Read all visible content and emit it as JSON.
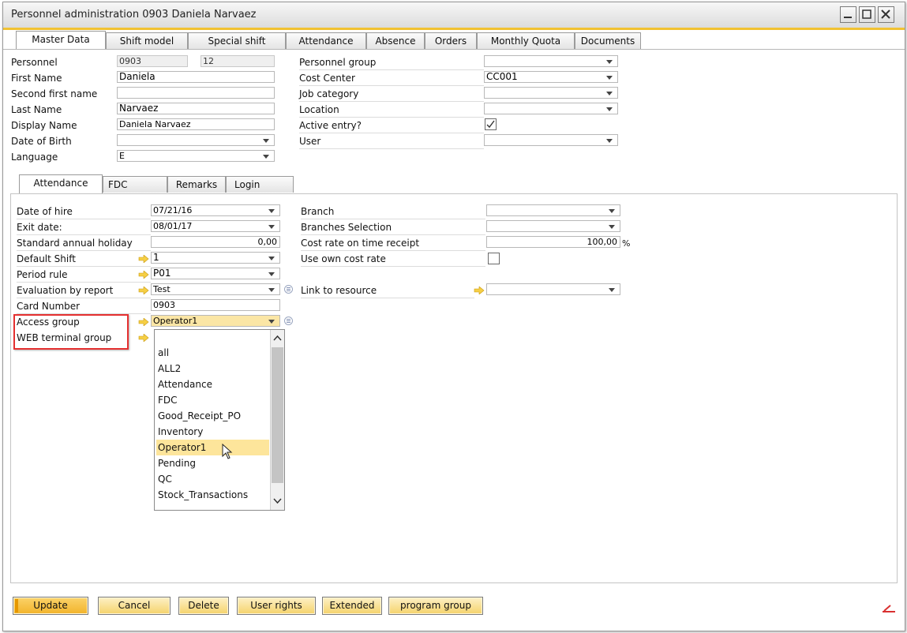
{
  "window": {
    "title": "Personnel administration 0903 Daniela Narvaez"
  },
  "main_tabs": [
    "Master Data",
    "Shift model",
    "Special shift",
    "Attendance",
    "Absence",
    "Orders",
    "Monthly Quota",
    "Documents"
  ],
  "header_left": {
    "personnel_label": "Personnel",
    "personnel_value": "0903",
    "personnel_value2": "12",
    "first_name_label": "First Name",
    "first_name_value": "Daniela",
    "second_first_name_label": "Second first name",
    "second_first_name_value": "",
    "last_name_label": "Last Name",
    "last_name_value": "Narvaez",
    "display_name_label": "Display Name",
    "display_name_value": "Daniela Narvaez",
    "dob_label": "Date of Birth",
    "dob_value": "",
    "language_label": "Language",
    "language_value": "E"
  },
  "header_right": {
    "personnel_group_label": "Personnel group",
    "personnel_group_value": "",
    "cost_center_label": "Cost Center",
    "cost_center_value": "CC001",
    "job_category_label": "Job category",
    "job_category_value": "",
    "location_label": "Location",
    "location_value": "",
    "active_entry_label": "Active entry?",
    "active_entry_checked": true,
    "user_label": "User",
    "user_value": ""
  },
  "sub_tabs": [
    "Attendance",
    "FDC",
    "Remarks",
    "Login"
  ],
  "attendance_left": {
    "date_of_hire_label": "Date of hire",
    "date_of_hire_value": "07/21/16",
    "exit_date_label": "Exit date:",
    "exit_date_value": "08/01/17",
    "annual_holiday_label": "Standard annual holiday",
    "annual_holiday_value": "0,00",
    "default_shift_label": "Default Shift",
    "default_shift_value": "1",
    "period_rule_label": "Period rule",
    "period_rule_value": "P01",
    "evaluation_label": "Evaluation by report",
    "evaluation_value": "Test",
    "card_number_label": "Card Number",
    "card_number_value": "0903",
    "access_group_label": "Access group",
    "access_group_value": "Operator1",
    "web_terminal_label": "WEB terminal group"
  },
  "attendance_right": {
    "branch_label": "Branch",
    "branch_value": "",
    "branches_selection_label": "Branches Selection",
    "branches_selection_value": "",
    "cost_rate_label": "Cost rate on time receipt",
    "cost_rate_value": "100,00",
    "cost_rate_unit": "%",
    "own_cost_rate_label": "Use own cost rate",
    "own_cost_rate_checked": false,
    "link_resource_label": "Link to resource",
    "link_resource_value": ""
  },
  "access_group_list": {
    "items": [
      "all",
      "ALL2",
      "Attendance",
      "FDC",
      "Good_Receipt_PO",
      "Inventory",
      "Operator1",
      "Pending",
      "QC",
      "Stock_Transactions"
    ],
    "selected": "Operator1"
  },
  "buttons": {
    "update": "Update",
    "cancel": "Cancel",
    "delete": "Delete",
    "user_rights": "User rights",
    "extended": "Extended",
    "program_group": "program group"
  },
  "colors": {
    "accent": "#f1c232",
    "highlight": "#fde59b",
    "annotation": "#e53030"
  }
}
